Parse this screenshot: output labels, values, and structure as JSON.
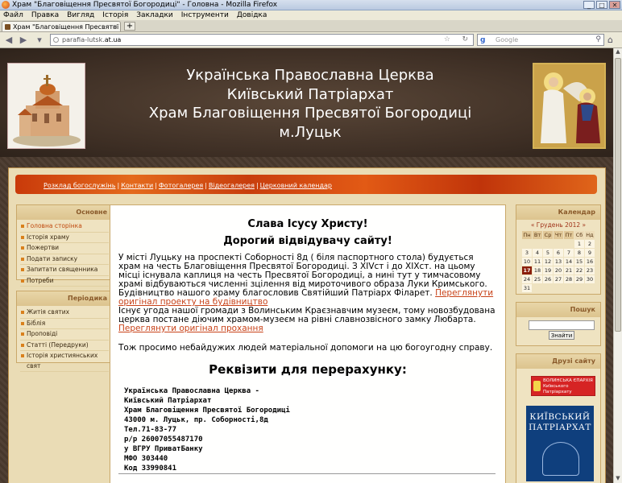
{
  "browser": {
    "window_title": "Храм \"Благовіщення Пресвятої Богородиці\" - Головна - Mozilla Firefox",
    "menu": [
      "Файл",
      "Правка",
      "Вигляд",
      "Історія",
      "Закладки",
      "Інструменти",
      "Довідка"
    ],
    "tab_title": "Храм \"Благовіщення Пресвятої Бого...",
    "url_prefix": "parafia-lutsk.",
    "url_host": "at.ua",
    "search_placeholder": "Google"
  },
  "header": {
    "line1": "Українська Православна Церква",
    "line2": "Київський Патріархат",
    "line3": "Храм Благовіщення Пресвятої Богородиці",
    "line4": "м.Луцьк"
  },
  "topnav": [
    "Розклад богослужінь",
    "Контакти",
    "Фотогалерея",
    "Відеогалерея",
    "Церковний календар"
  ],
  "sidebar_left": {
    "main_title": "Основне",
    "main_items": [
      "Головна сторінка",
      "Історія храму",
      "Пожертви",
      "Подати записку",
      "Запитати священника",
      "Потреби"
    ],
    "periodic_title": "Періодика",
    "periodic_items": [
      "Житія святих",
      "Біблія",
      "Проповіді",
      "Статті (Передруки)",
      "Історія християнських свят"
    ]
  },
  "content": {
    "heading1": "Слава Ісусу Христу!",
    "heading2": "Дорогий відвідувачу сайту!",
    "para1": "У місті Луцьку на проспекті Соборності 8д ( біля паспортного стола) будується храм на честь Благовіщення Пресвятої Богородиці. З XIVст і до XIXст. на цьому місці існувала каплиця на честь Пресвятої Богородиці, а нині тут у тимчасовому храмі відбуваються численні зцілення від мироточивого образа Луки Кримського. Будівництво нашого храму благословив Святійший Патріарх Філарет. ",
    "link1": "Переглянути оригінал проекту на будівництво",
    "para2": "Існує угода нашої громади з Волинським Краєзнавчим музеєм, тому новозбудована церква постане діючим храмом-музеєм на рівні славнозвісного замку Любарта. ",
    "link2": "Переглянути оригінал прохання",
    "para3": "Тож просимо небайдужих людей матеріальної допомоги на цю богоугодну справу.",
    "heading3": "Реквізити для перерахунку:",
    "requisites": "Українська Православна Церква -\nКиївський Патріархат\nХрам Благовіщення Пресвятої Богородиці\n43000 м. Луцьк, пр. Соборності,8д\nТел.71-83-77\nр/р 26007055487170\nу ВГРУ ПриватБанку\nМФО 303440\nКод 33990841"
  },
  "sidebar_right": {
    "calendar_title": "Календар",
    "calendar_month": "« Грудень 2012 »",
    "weekdays": [
      "Пн",
      "Вт",
      "Ср",
      "Чт",
      "Пт",
      "Сб",
      "Нд"
    ],
    "weeks": [
      [
        "",
        "",
        "",
        "",
        "",
        "1",
        "2"
      ],
      [
        "3",
        "4",
        "5",
        "6",
        "7",
        "8",
        "9"
      ],
      [
        "10",
        "11",
        "12",
        "13",
        "14",
        "15",
        "16"
      ],
      [
        "17",
        "18",
        "19",
        "20",
        "21",
        "22",
        "23"
      ],
      [
        "24",
        "25",
        "26",
        "27",
        "28",
        "29",
        "30"
      ],
      [
        "31",
        "",
        "",
        "",
        "",
        "",
        ""
      ]
    ],
    "today": "17",
    "search_title": "Пошук",
    "search_button": "Знайти",
    "friends_title": "Друзі сайту",
    "banner1_text": "ВОЛИНСЬКА ЄПАРХІЯ Київського Патріархату",
    "banner2_text": "КИЇВСЬКИЙ ПАТРІАРХАТ"
  }
}
